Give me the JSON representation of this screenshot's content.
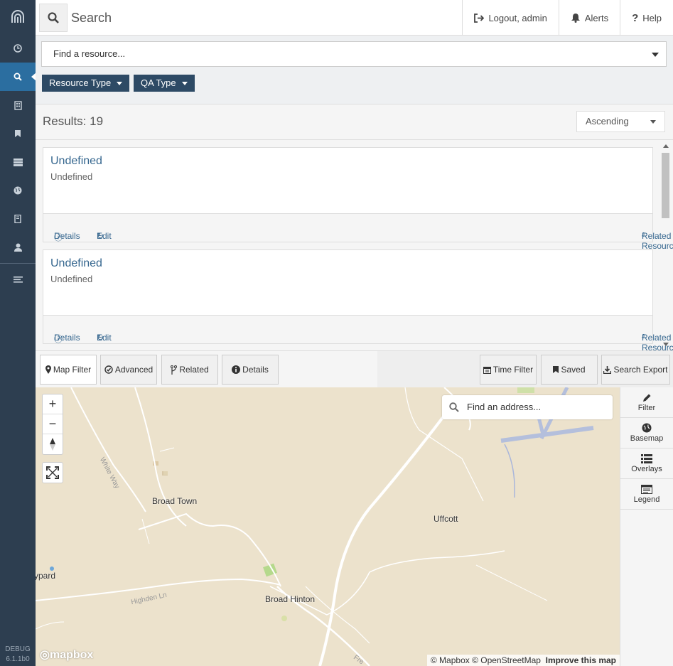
{
  "sidebar": {
    "items": [
      {
        "icon": "clock-icon",
        "name": "nav-recent"
      },
      {
        "icon": "search-icon",
        "name": "nav-search",
        "active": true
      },
      {
        "icon": "building-icon",
        "name": "nav-building"
      },
      {
        "icon": "bookmark-icon",
        "name": "nav-bookmarks"
      },
      {
        "icon": "stack-icon",
        "name": "nav-stack"
      },
      {
        "icon": "globe-icon",
        "name": "nav-globe"
      },
      {
        "icon": "book-icon",
        "name": "nav-book"
      },
      {
        "icon": "user-icon",
        "name": "nav-profile"
      }
    ],
    "debug_label": "DEBUG",
    "version": "6.1.1b0"
  },
  "topbar": {
    "title": "Search",
    "logout_label": "Logout, admin",
    "alerts_label": "Alerts",
    "help_label": "Help"
  },
  "search": {
    "resource_placeholder": "Find a resource...",
    "filters": [
      "Resource Type",
      "QA Type"
    ]
  },
  "results": {
    "count_label": "Results: 19",
    "sort_value": "Ascending",
    "items": [
      {
        "name": "Undefined",
        "type": "Undefined",
        "details": "Details",
        "edit": "Edit",
        "related": "Related Resources"
      },
      {
        "name": "Undefined",
        "type": "Undefined",
        "details": "Details",
        "edit": "Edit",
        "related": "Related Resources"
      }
    ]
  },
  "tabs": {
    "map_filter": "Map Filter",
    "advanced": "Advanced",
    "related": "Related",
    "details": "Details",
    "time_filter": "Time Filter",
    "saved": "Saved",
    "search_export": "Search Export"
  },
  "map": {
    "geocoder_placeholder": "Find an address...",
    "places": [
      "Broad Town",
      "Uffcott",
      "Broad Hinton",
      "ypard"
    ],
    "roads": [
      "White Way",
      "Highden Ln",
      "Fre"
    ],
    "attribution": "© Mapbox © OpenStreetMap",
    "improve_label": "Improve this map",
    "logo_text": "mapbox",
    "zoom_in": "+",
    "zoom_out": "−"
  },
  "map_tools": [
    "Filter",
    "Basemap",
    "Overlays",
    "Legend"
  ],
  "colors": {
    "sidebar": "#2d3e50",
    "active_nav": "#2b6ea0",
    "filter_button": "#2d4a65",
    "link": "#36678f",
    "map_land": "#ece2cc"
  }
}
